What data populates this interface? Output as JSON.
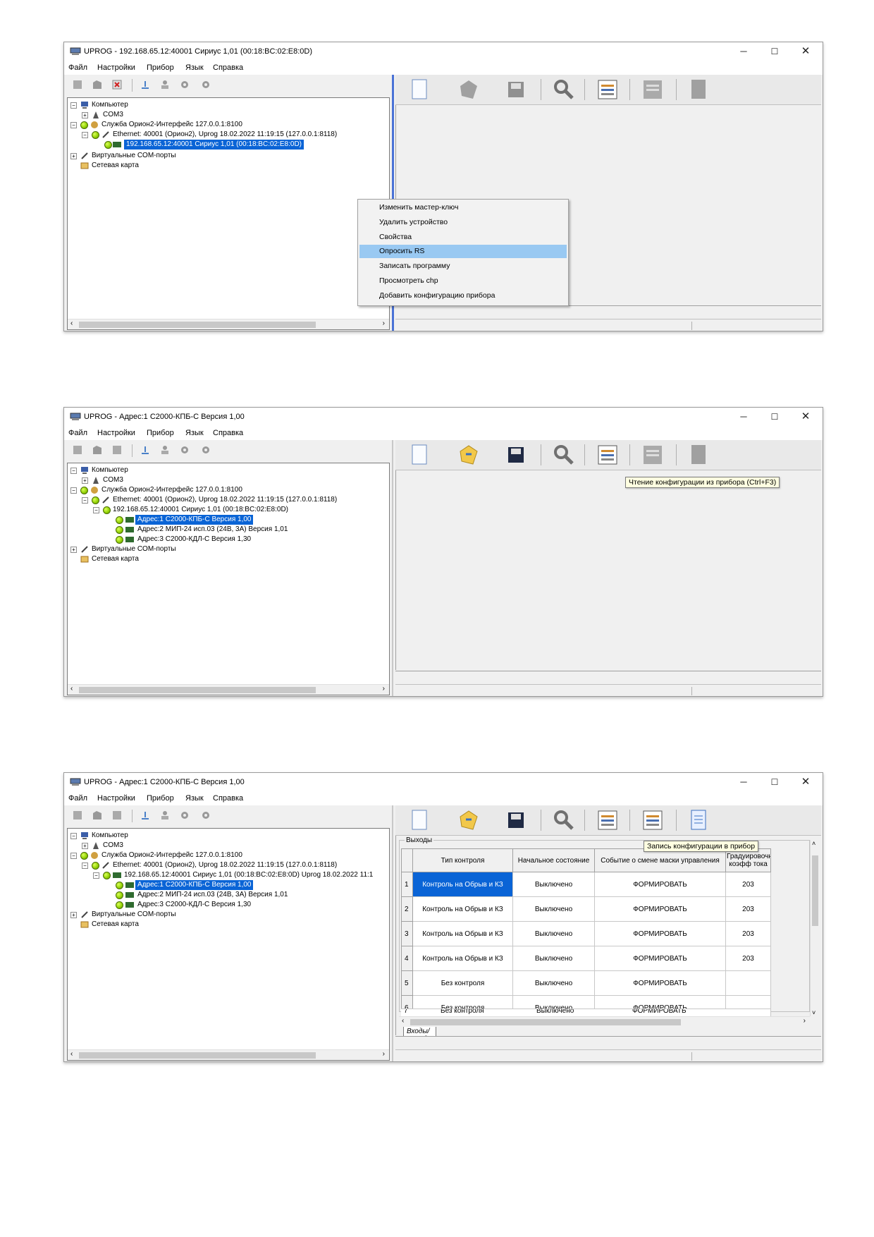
{
  "windows": [
    {
      "title": "UPROG -  192.168.65.12:40001 Сириус 1,01 (00:18:BC:02:E8:0D)",
      "menu": [
        "Файл",
        "Настройки",
        "Прибор",
        "Язык",
        "Справка"
      ],
      "tree": [
        {
          "label": "Компьютер"
        },
        {
          "label": "COM3"
        },
        {
          "label": "Служба Орион2-Интерфейс 127.0.0.1:8100"
        },
        {
          "label": "Ethernet: 40001   (Орион2), Uprog 18.02.2022 11:19:15 (127.0.0.1:8118)"
        },
        {
          "label": "192.168.65.12:40001 Сириус 1,01 (00:18:BC:02:E8:0D)"
        },
        {
          "label": "Виртуальные COM-порты"
        },
        {
          "label": "Сетевая карта"
        }
      ],
      "context_menu": [
        "Изменить мастер-ключ",
        "Удалить устройство",
        "Свойства",
        "Опросить RS",
        "Записать программу",
        "Просмотреть chp",
        "Добавить конфигурацию прибора"
      ]
    },
    {
      "title": "UPROG - Адрес:1 С2000-КПБ-С Версия 1,00",
      "menu": [
        "Файл",
        "Настройки",
        "Прибор",
        "Язык",
        "Справка"
      ],
      "tree": [
        {
          "label": "Компьютер"
        },
        {
          "label": "COM3"
        },
        {
          "label": "Служба Орион2-Интерфейс 127.0.0.1:8100"
        },
        {
          "label": "Ethernet: 40001   (Орион2), Uprog 18.02.2022 11:19:15 (127.0.0.1:8118)"
        },
        {
          "label": "192.168.65.12:40001 Сириус 1,01 (00:18:BC:02:E8:0D)"
        },
        {
          "label": "Адрес:1 С2000-КПБ-С Версия 1,00"
        },
        {
          "label": "Адрес:2 МИП-24 исп.03 (24В, 3А) Версия 1,01"
        },
        {
          "label": "Адрес:3 С2000-КДЛ-С Версия 1,30"
        },
        {
          "label": "Виртуальные COM-порты"
        },
        {
          "label": "Сетевая карта"
        }
      ],
      "tooltip": "Чтение конфигурации из прибора (Ctrl+F3)"
    },
    {
      "title": "UPROG - Адрес:1 С2000-КПБ-С Версия 1,00",
      "menu": [
        "Файл",
        "Настройки",
        "Прибор",
        "Язык",
        "Справка"
      ],
      "tree": [
        {
          "label": "Компьютер"
        },
        {
          "label": "COM3"
        },
        {
          "label": "Служба Орион2-Интерфейс 127.0.0.1:8100"
        },
        {
          "label": "Ethernet: 40001   (Орион2), Uprog 18.02.2022 11:19:15 (127.0.0.1:8118)"
        },
        {
          "label": "192.168.65.12:40001 Сириус 1,01 (00:18:BC:02:E8:0D)  Uprog 18.02.2022 11:1"
        },
        {
          "label": "Адрес:1 С2000-КПБ-С Версия 1,00"
        },
        {
          "label": "Адрес:2 МИП-24 исп.03 (24В, 3А) Версия 1,01"
        },
        {
          "label": "Адрес:3 С2000-КДЛ-С Версия 1,30"
        },
        {
          "label": "Виртуальные COM-порты"
        },
        {
          "label": "Сетевая карта"
        }
      ],
      "tooltip": "Запись конфигурации в прибор",
      "group_label": "Выходы",
      "table": {
        "headers": [
          "Тип контроля",
          "Начальное состояние",
          "Событие о смене маски управления",
          "Градуировочный коэфф тока"
        ],
        "rows": [
          {
            "n": "1",
            "type": "Контроль на Обрыв и КЗ",
            "state": "Выключено",
            "event": "ФОРМИРОВАТЬ",
            "coef": "203"
          },
          {
            "n": "2",
            "type": "Контроль на Обрыв и КЗ",
            "state": "Выключено",
            "event": "ФОРМИРОВАТЬ",
            "coef": "203"
          },
          {
            "n": "3",
            "type": "Контроль на Обрыв и КЗ",
            "state": "Выключено",
            "event": "ФОРМИРОВАТЬ",
            "coef": "203"
          },
          {
            "n": "4",
            "type": "Контроль на Обрыв и КЗ",
            "state": "Выключено",
            "event": "ФОРМИРОВАТЬ",
            "coef": "203"
          },
          {
            "n": "5",
            "type": "Без контроля",
            "state": "Выключено",
            "event": "ФОРМИРОВАТЬ",
            "coef": ""
          },
          {
            "n": "6",
            "type": "Без контроля",
            "state": "Выключено",
            "event": "ФОРМИРОВАТЬ",
            "coef": ""
          },
          {
            "n": "7",
            "type": "Без контроля",
            "state": "Выключено",
            "event": "ФОРМИРОВАТЬ",
            "coef": ""
          }
        ]
      },
      "tab_label": "Входы/Выходы"
    }
  ],
  "colors": {
    "selection": "#0a64d6",
    "menu_highlight": "#99c9f2",
    "splitter": "#4a72d6",
    "tooltip_bg": "#ffffe1"
  }
}
